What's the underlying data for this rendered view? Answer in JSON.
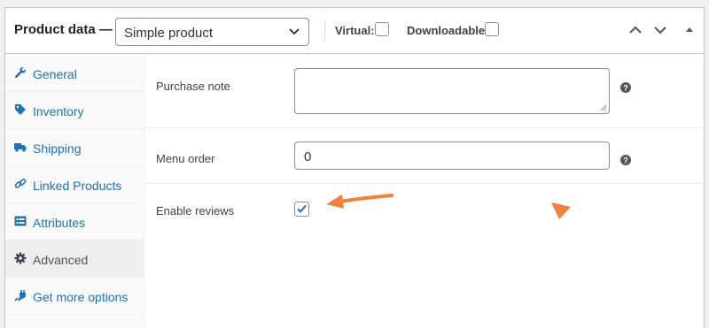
{
  "header": {
    "title": "Product data —",
    "product_type": "Simple product",
    "virtual_label": "Virtual:",
    "downloadable_label": "Downloadable:"
  },
  "sidebar": {
    "items": [
      {
        "label": "General",
        "icon": "wrench-icon"
      },
      {
        "label": "Inventory",
        "icon": "tag-icon"
      },
      {
        "label": "Shipping",
        "icon": "truck-icon"
      },
      {
        "label": "Linked Products",
        "icon": "link-icon"
      },
      {
        "label": "Attributes",
        "icon": "list-icon"
      },
      {
        "label": "Advanced",
        "icon": "gear-icon",
        "active": true
      },
      {
        "label": "Get more options",
        "icon": "plugin-icon"
      }
    ]
  },
  "fields": {
    "purchase_note": {
      "label": "Purchase note",
      "value": ""
    },
    "menu_order": {
      "label": "Menu order",
      "value": "0"
    },
    "enable_reviews": {
      "label": "Enable reviews",
      "checked": true
    }
  },
  "colors": {
    "link": "#2271b1",
    "checkmark": "#2271b1",
    "annotation_arrow": "#f0803c"
  }
}
